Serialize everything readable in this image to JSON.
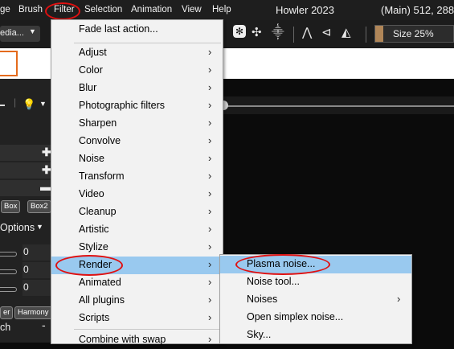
{
  "menubar": {
    "items": [
      "ge",
      "Brush",
      "Filter",
      "Selection",
      "Animation",
      "View",
      "Help"
    ],
    "title": "Howler 2023",
    "status": "(Main)",
    "coords": "512, 288"
  },
  "toolbar": {
    "media_label": "edia...",
    "size_label": "Size 25%"
  },
  "left_panel": {
    "tabs": [
      "Box",
      "Box2"
    ],
    "options_label": "Options",
    "values": [
      "0",
      "0",
      "0"
    ],
    "tabs2": [
      "er",
      "Harmony"
    ],
    "bottom_label": "ch"
  },
  "filter_menu": {
    "fade": "Fade last action...",
    "items": [
      "Adjust",
      "Color",
      "Blur",
      "Photographic filters",
      "Sharpen",
      "Convolve",
      "Noise",
      "Transform",
      "Video",
      "Cleanup",
      "Artistic",
      "Stylize",
      "Render",
      "Animated",
      "All plugins",
      "Scripts",
      "Combine with swap"
    ]
  },
  "render_submenu": {
    "items": [
      "Plasma noise...",
      "Noise tool...",
      "Noises",
      "Open simplex noise...",
      "Sky..."
    ]
  },
  "colors": {
    "menubar_bg": "#1e1e1e",
    "menu_bg": "#f2f2f2",
    "highlight": "#99c9ef",
    "annotation_red": "#e01010",
    "accent_orange": "#e46a1c"
  }
}
